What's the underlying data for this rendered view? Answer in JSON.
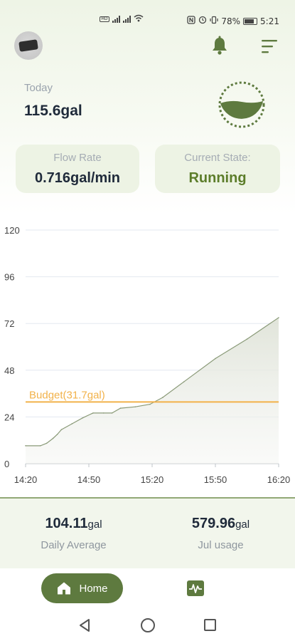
{
  "status_bar": {
    "battery": "78%",
    "time": "5:21"
  },
  "header": {
    "avatar_icon": "device-avatar-icon",
    "bell_icon": "bell-icon",
    "menu_icon": "menu-lines-icon",
    "accent_color": "#5e7a3f"
  },
  "today": {
    "label": "Today",
    "value": "115.6gal"
  },
  "cards": {
    "flow_label": "Flow Rate",
    "flow_value": "0.716gal/min",
    "state_label": "Current State:",
    "state_value": "Running",
    "state_color": "#5c7d2a"
  },
  "chart_data": {
    "type": "area",
    "x_ticks": [
      "14:20",
      "14:50",
      "15:20",
      "15:50",
      "16:20"
    ],
    "y_ticks": [
      0,
      24,
      48,
      72,
      96,
      120
    ],
    "ylim": [
      0,
      120
    ],
    "xlim": [
      "14:20",
      "16:20"
    ],
    "grid": true,
    "line_color": "#8a9a78",
    "budget": {
      "label": "Budget(31.7gal)",
      "value": 31.7,
      "color": "#f2b24a"
    },
    "points": [
      [
        "14:20",
        9.2
      ],
      [
        "14:27",
        9.2
      ],
      [
        "14:30",
        10.5
      ],
      [
        "14:33",
        13
      ],
      [
        "14:35",
        15
      ],
      [
        "14:37",
        17.5
      ],
      [
        "14:42",
        20.5
      ],
      [
        "14:47",
        23.5
      ],
      [
        "14:52",
        26
      ],
      [
        "14:57",
        26
      ],
      [
        "15:01",
        26
      ],
      [
        "15:05",
        28.5
      ],
      [
        "15:12",
        29.2
      ],
      [
        "15:19",
        30.5
      ],
      [
        "15:25",
        34
      ],
      [
        "15:35",
        42
      ],
      [
        "15:50",
        54
      ],
      [
        "16:05",
        64
      ],
      [
        "16:20",
        75
      ]
    ]
  },
  "stats": {
    "daily_value": "104.11",
    "daily_unit": "gal",
    "daily_label": "Daily Average",
    "month_value": "579.96",
    "month_unit": "gal",
    "month_label": "Jul usage"
  },
  "nav": {
    "home_label": "Home",
    "home_icon": "home-icon",
    "stats_icon": "activity-chart-icon"
  }
}
